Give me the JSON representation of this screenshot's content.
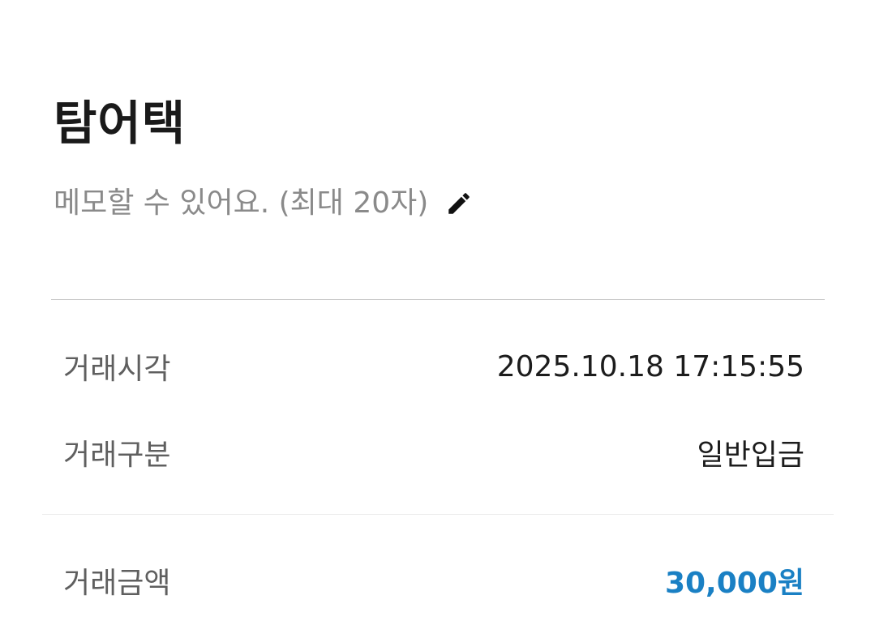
{
  "header": {
    "title": "탐어택",
    "memo_placeholder": "메모할 수 있어요. (최대 20자)",
    "edit_icon": "pencil-icon"
  },
  "details": {
    "time_label": "거래시각",
    "time_value": "2025.10.18 17:15:55",
    "type_label": "거래구분",
    "type_value": "일반입금",
    "amount_label": "거래금액",
    "amount_value": "30,000원"
  },
  "colors": {
    "amount": "#1a80c4",
    "title": "#1a1a1a",
    "memo": "#8a8a8a",
    "label": "#5f5f5f"
  }
}
